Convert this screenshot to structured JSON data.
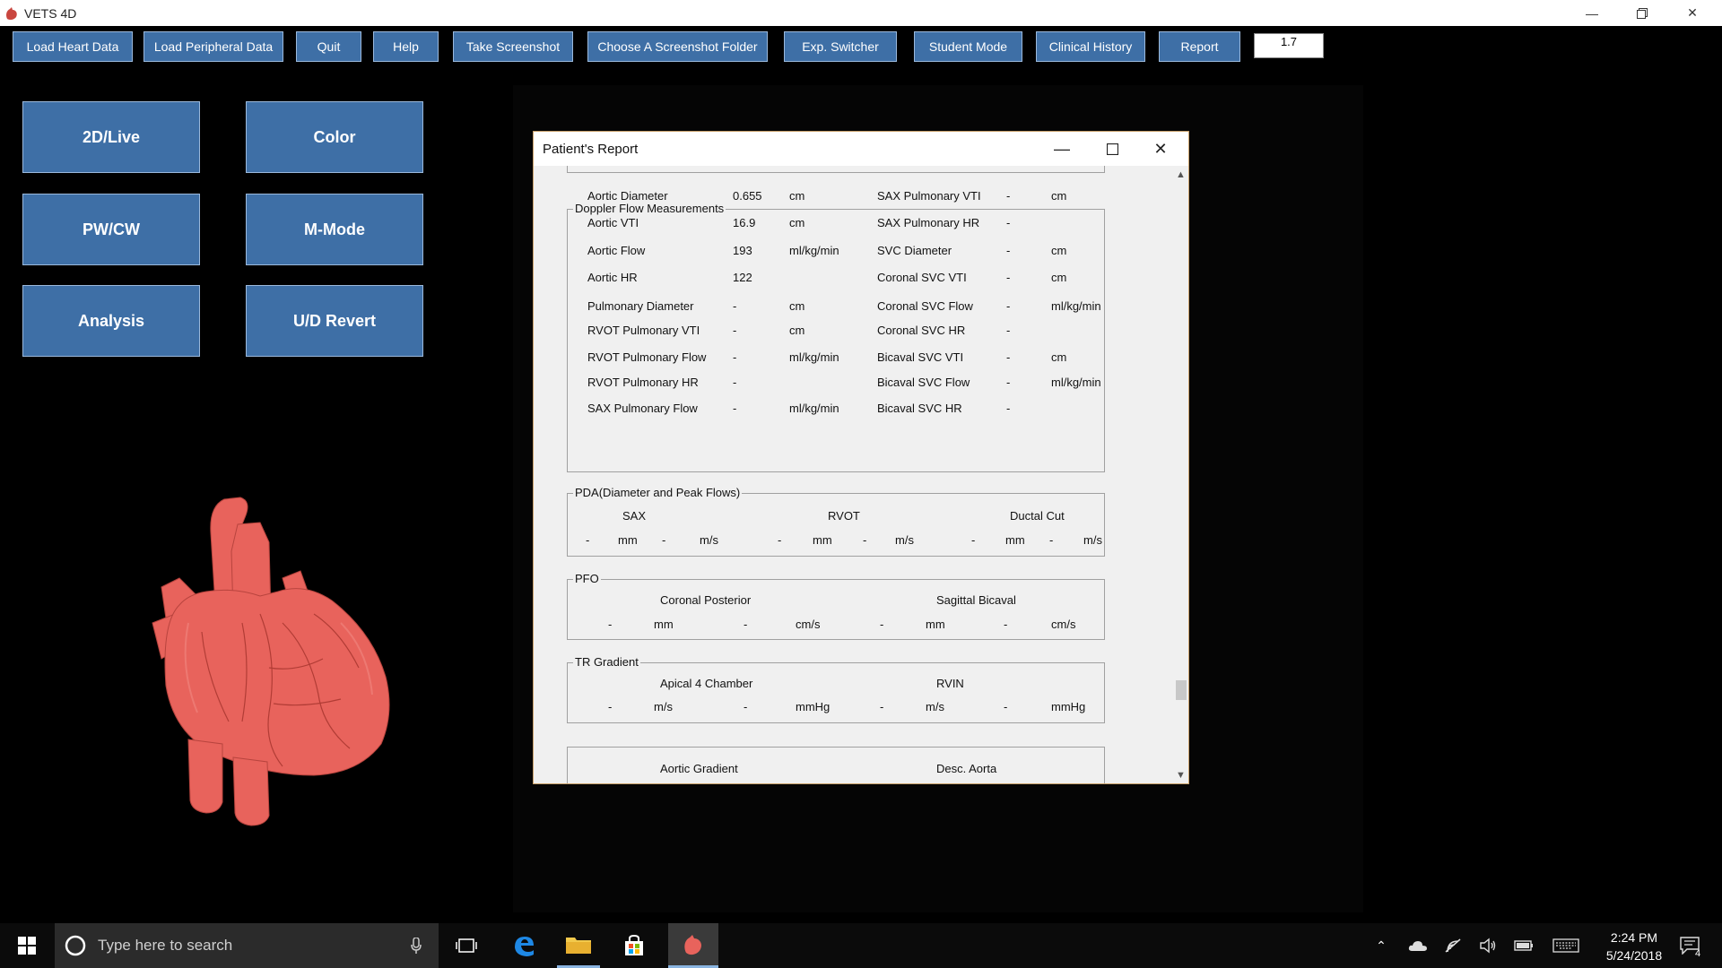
{
  "app": {
    "title": "VETS 4D",
    "colors": {
      "button_bg": "#3e6fa6",
      "heart": "#e8635c",
      "taskbar": "#0b0b0b"
    }
  },
  "toolbar": {
    "buttons": [
      "Load Heart Data",
      "Load Peripheral Data",
      "Quit",
      "Help",
      "Take Screenshot",
      "Choose A Screenshot Folder",
      "Exp. Switcher",
      "Student Mode",
      "Clinical History",
      "Report"
    ],
    "value": "1.7"
  },
  "modes": [
    "2D/Live",
    "Color",
    "PW/CW",
    "M-Mode",
    "Analysis",
    "U/D Revert"
  ],
  "report": {
    "title": "Patient's Report",
    "doppler": {
      "title": "Doppler Flow Measurements",
      "left": [
        {
          "label": "Aortic Diameter",
          "value": "0.655",
          "unit": "cm"
        },
        {
          "label": "Aortic VTI",
          "value": "16.9",
          "unit": "cm"
        },
        {
          "label": "Aortic Flow",
          "value": "193",
          "unit": "ml/kg/min"
        },
        {
          "label": "Aortic HR",
          "value": "122",
          "unit": ""
        },
        {
          "label": "Pulmonary Diameter",
          "value": "-",
          "unit": "cm"
        },
        {
          "label": "RVOT Pulmonary VTI",
          "value": "-",
          "unit": "cm"
        },
        {
          "label": "RVOT Pulmonary Flow",
          "value": "-",
          "unit": "ml/kg/min"
        },
        {
          "label": "RVOT Pulmonary HR",
          "value": "-",
          "unit": ""
        },
        {
          "label": "SAX Pulmonary Flow",
          "value": "-",
          "unit": "ml/kg/min"
        }
      ],
      "right": [
        {
          "label": "SAX Pulmonary VTI",
          "value": "-",
          "unit": "cm"
        },
        {
          "label": "SAX Pulmonary HR",
          "value": "-",
          "unit": ""
        },
        {
          "label": "SVC Diameter",
          "value": "-",
          "unit": "cm"
        },
        {
          "label": "Coronal SVC VTI",
          "value": "-",
          "unit": "cm"
        },
        {
          "label": "Coronal SVC Flow",
          "value": "-",
          "unit": "ml/kg/min"
        },
        {
          "label": "Coronal SVC HR",
          "value": "-",
          "unit": ""
        },
        {
          "label": "Bicaval SVC VTI",
          "value": "-",
          "unit": "cm"
        },
        {
          "label": "Bicaval SVC Flow",
          "value": "-",
          "unit": "ml/kg/min"
        },
        {
          "label": "Bicaval SVC HR",
          "value": "-",
          "unit": ""
        }
      ]
    },
    "pda": {
      "title": "PDA(Diameter and Peak Flows)",
      "columns": [
        {
          "header": "SAX",
          "diam": "-",
          "diam_unit": "mm",
          "flow": "-",
          "flow_unit": "m/s"
        },
        {
          "header": "RVOT",
          "diam": "-",
          "diam_unit": "mm",
          "flow": "-",
          "flow_unit": "m/s"
        },
        {
          "header": "Ductal Cut",
          "diam": "-",
          "diam_unit": "mm",
          "flow": "-",
          "flow_unit": "m/s"
        }
      ]
    },
    "pfo": {
      "title": "PFO",
      "columns": [
        {
          "header": "Coronal Posterior",
          "a": "-",
          "a_unit": "mm",
          "b": "-",
          "b_unit": "cm/s"
        },
        {
          "header": "Sagittal Bicaval",
          "a": "-",
          "a_unit": "mm",
          "b": "-",
          "b_unit": "cm/s"
        }
      ]
    },
    "tr": {
      "title": "TR Gradient",
      "columns": [
        {
          "header": "Apical 4 Chamber",
          "a": "-",
          "a_unit": "m/s",
          "b": "-",
          "b_unit": "mmHg"
        },
        {
          "header": "RVIN",
          "a": "-",
          "a_unit": "m/s",
          "b": "-",
          "b_unit": "mmHg"
        }
      ]
    },
    "gradient": {
      "left": "Aortic Gradient",
      "right": "Desc. Aorta"
    }
  },
  "taskbar": {
    "search_placeholder": "Type here to search",
    "time": "2:24 PM",
    "date": "5/24/2018",
    "notification_count": "4"
  }
}
